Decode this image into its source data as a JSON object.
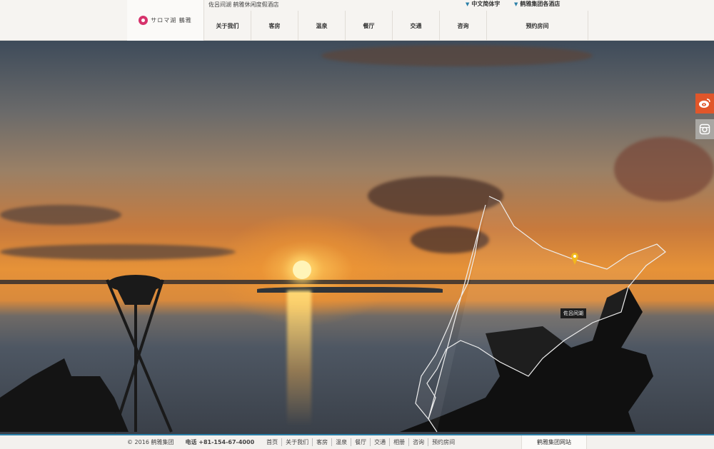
{
  "header": {
    "logo_text": "サロマ湖 鶴雅",
    "tagline": "佐呂间湖 鹤雅休闲度假酒店",
    "language": "中文简体字",
    "group_hotels": "鹤雅集团各酒店"
  },
  "nav": {
    "items": [
      {
        "label": "关于我们"
      },
      {
        "label": "客房"
      },
      {
        "label": "温泉"
      },
      {
        "label": "餐厅"
      },
      {
        "label": "交通"
      },
      {
        "label": "咨询"
      },
      {
        "label": "预约房间"
      }
    ]
  },
  "hero": {
    "map_label": "佐呂间湖",
    "carousel": {
      "count": 8,
      "active_index": 6
    }
  },
  "social": {
    "weibo_icon": "weibo-icon",
    "instagram_icon": "instagram-icon"
  },
  "footer": {
    "copyright": "© 2016 鹤雅集团",
    "phone": "电话 +81-154-67-4000",
    "links": [
      "首页",
      "关于我们",
      "客房",
      "温泉",
      "餐厅",
      "交通",
      "相册",
      "咨询",
      "预约房间"
    ],
    "group_site": "鹤雅集团网站"
  },
  "colors": {
    "accent": "#2a7fa8",
    "weibo": "#e0562a",
    "instagram": "#a9a7a3"
  }
}
